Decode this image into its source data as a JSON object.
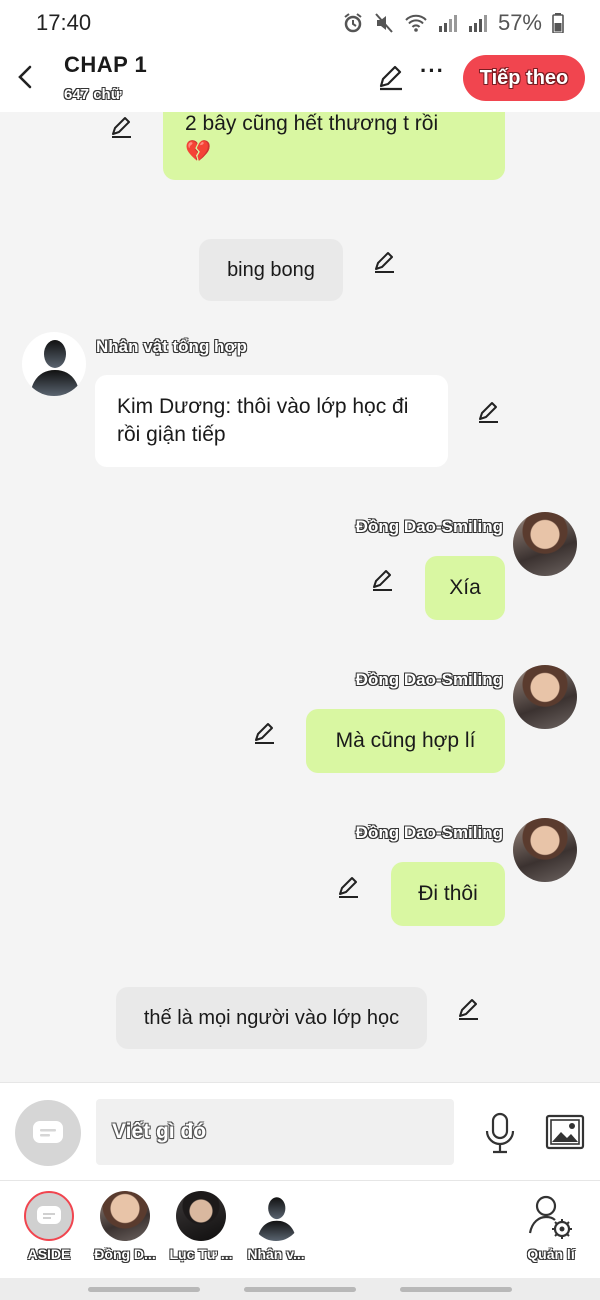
{
  "status_bar": {
    "time": "17:40",
    "battery": "57%"
  },
  "header": {
    "title": "CHAP 1",
    "word_count": "647 chữ",
    "more_label": "···",
    "next_label": "Tiếp theo",
    "accent_color": "#f1454f"
  },
  "messages": [
    {
      "kind": "right",
      "text": "2 bây cũng hết thương t rồi",
      "emoji": "💔"
    },
    {
      "kind": "narration",
      "text": "bing bong"
    },
    {
      "kind": "left",
      "character": "Nhân vật tổng hợp",
      "text": "Kim Dương: thôi vào lớp học đi rồi giận tiếp"
    },
    {
      "kind": "right",
      "character": "Đồng Dao-Smiling",
      "text": "Xía"
    },
    {
      "kind": "right",
      "character": "Đồng Dao-Smiling",
      "text": "Mà cũng hợp lí"
    },
    {
      "kind": "right",
      "character": "Đồng Dao-Smiling",
      "text": "Đi thôi"
    },
    {
      "kind": "narration",
      "text": "thế là mọi người vào lớp học"
    }
  ],
  "input": {
    "placeholder": "Viết gì đó"
  },
  "characters": [
    {
      "label": "ASIDE",
      "icon": "chat-bubble-icon"
    },
    {
      "label": "Đồng D..."
    },
    {
      "label": "Lục Tư ..."
    },
    {
      "label": "Nhân v..."
    }
  ],
  "manage_label": "Quản lí",
  "colors": {
    "bubble_green": "#d9f7a2",
    "bubble_white": "#ffffff",
    "bubble_grey": "#e9e9e9",
    "background": "#f4f4f4"
  }
}
